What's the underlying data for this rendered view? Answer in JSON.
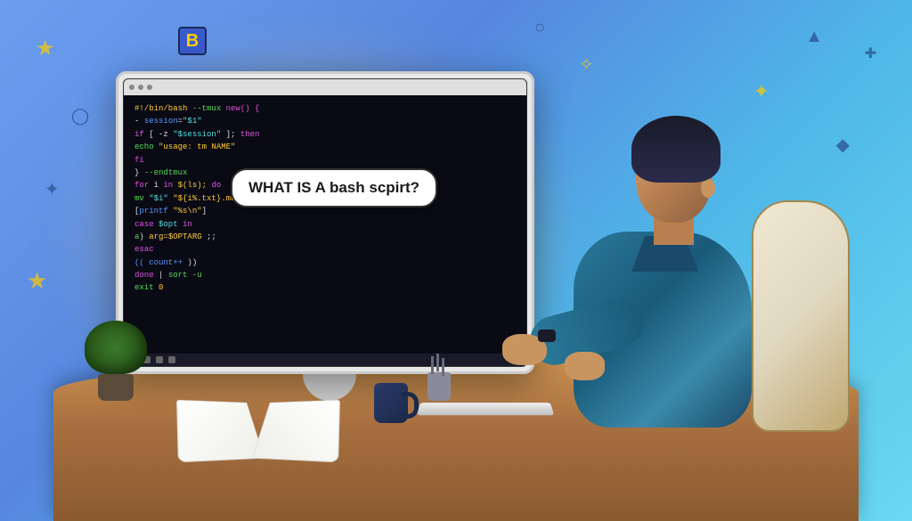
{
  "speech_bubble": {
    "text": "WHAT IS A bash scpirt?"
  },
  "badge": {
    "letter": "B"
  },
  "code_lines": [
    {
      "segments": [
        {
          "cls": "c-y",
          "t": "#!/bin/bash"
        },
        {
          "cls": "c-w",
          "t": "  "
        },
        {
          "cls": "c-g",
          "t": "--tmux"
        },
        {
          "cls": "c-p",
          "t": " new() {"
        }
      ]
    },
    {
      "segments": [
        {
          "cls": "c-w",
          "t": "  - "
        },
        {
          "cls": "c-b",
          "t": "session"
        },
        {
          "cls": "c-w",
          "t": "="
        },
        {
          "cls": "c-c",
          "t": "\"$1\""
        }
      ]
    },
    {
      "segments": [
        {
          "cls": "c-p",
          "t": "  if"
        },
        {
          "cls": "c-w",
          "t": " [ -z "
        },
        {
          "cls": "c-c",
          "t": "\"$session\""
        },
        {
          "cls": "c-w",
          "t": " ]; "
        },
        {
          "cls": "c-p",
          "t": "then"
        }
      ]
    },
    {
      "segments": [
        {
          "cls": "c-g",
          "t": "    echo"
        },
        {
          "cls": "c-y",
          "t": " \"usage: tm NAME\""
        }
      ]
    },
    {
      "segments": [
        {
          "cls": "c-p",
          "t": "  fi"
        }
      ]
    },
    {
      "segments": [
        {
          "cls": "c-w",
          "t": ""
        }
      ]
    },
    {
      "segments": [
        {
          "cls": "c-w",
          "t": ""
        }
      ]
    },
    {
      "segments": [
        {
          "cls": "c-w",
          "t": ""
        }
      ]
    },
    {
      "segments": [
        {
          "cls": "c-w",
          "t": "} "
        },
        {
          "cls": "c-g",
          "t": "--endtmux"
        }
      ]
    },
    {
      "segments": [
        {
          "cls": "c-p",
          "t": "for"
        },
        {
          "cls": "c-w",
          "t": " i "
        },
        {
          "cls": "c-p",
          "t": "in"
        },
        {
          "cls": "c-y",
          "t": " $(ls); "
        },
        {
          "cls": "c-p",
          "t": "do"
        }
      ]
    },
    {
      "segments": [
        {
          "cls": "c-g",
          "t": "  mv"
        },
        {
          "cls": "c-c",
          "t": " \"$i\""
        },
        {
          "cls": "c-w",
          "t": " "
        },
        {
          "cls": "c-y",
          "t": "\"${i%.txt}.md\""
        }
      ]
    },
    {
      "segments": [
        {
          "cls": "c-w",
          "t": "  ["
        },
        {
          "cls": "c-b",
          "t": "printf"
        },
        {
          "cls": "c-w",
          "t": " "
        },
        {
          "cls": "c-y",
          "t": "\"%s\\n\""
        },
        {
          "cls": "c-w",
          "t": "]"
        }
      ]
    },
    {
      "segments": [
        {
          "cls": "c-p",
          "t": "  case"
        },
        {
          "cls": "c-c",
          "t": " $opt"
        },
        {
          "cls": "c-p",
          "t": " in"
        }
      ]
    },
    {
      "segments": [
        {
          "cls": "c-g",
          "t": "    a"
        },
        {
          "cls": "c-w",
          "t": ") "
        },
        {
          "cls": "c-y",
          "t": "arg=$OPTARG"
        },
        {
          "cls": "c-w",
          "t": " ;;"
        }
      ]
    },
    {
      "segments": [
        {
          "cls": "c-p",
          "t": "  esac"
        }
      ]
    },
    {
      "segments": [
        {
          "cls": "c-w",
          "t": "  "
        },
        {
          "cls": "c-b",
          "t": "(( count++"
        },
        {
          "cls": "c-w",
          "t": " ))"
        }
      ]
    },
    {
      "segments": [
        {
          "cls": "c-p",
          "t": "done"
        },
        {
          "cls": "c-w",
          "t": " | "
        },
        {
          "cls": "c-g",
          "t": "sort -u"
        }
      ]
    },
    {
      "segments": [
        {
          "cls": "c-g",
          "t": "exit"
        },
        {
          "cls": "c-y",
          "t": " 0"
        }
      ]
    }
  ]
}
